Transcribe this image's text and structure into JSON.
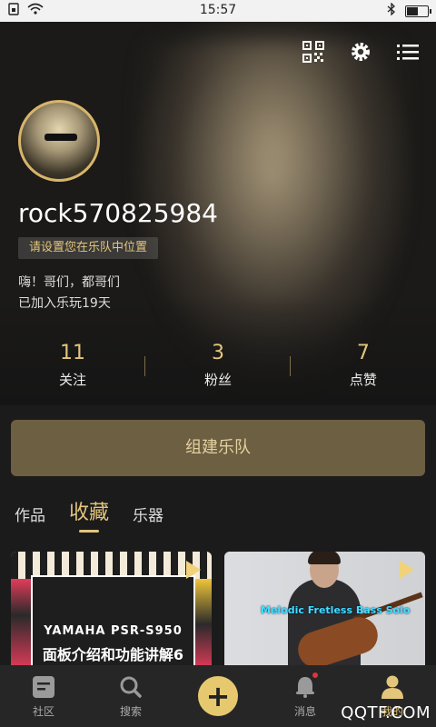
{
  "status_bar": {
    "time": "15:57"
  },
  "profile": {
    "username": "rock570825984",
    "position_tag": "请设置您在乐队中位置",
    "bio": "嗨！哥们，都哥们",
    "joined": "已加入乐玩19天"
  },
  "stats": [
    {
      "value": "11",
      "label": "关注"
    },
    {
      "value": "3",
      "label": "粉丝"
    },
    {
      "value": "7",
      "label": "点赞"
    }
  ],
  "form_band_label": "组建乐队",
  "tabs": [
    {
      "label": "作品",
      "active": false
    },
    {
      "label": "收藏",
      "active": true
    },
    {
      "label": "乐器",
      "active": false
    }
  ],
  "cards": [
    {
      "line1": "YAMAHA PSR-S950",
      "line2": "面板介绍和功能讲解6"
    },
    {
      "caption": "Melodic Fretless Bass Solo"
    }
  ],
  "bottom_nav": [
    {
      "label": "社区",
      "icon": "community-icon"
    },
    {
      "label": "搜索",
      "icon": "search-icon"
    },
    {
      "label": "",
      "icon": "plus-icon"
    },
    {
      "label": "消息",
      "icon": "bell-icon"
    },
    {
      "label": "我的",
      "icon": "profile-icon",
      "active": true
    }
  ],
  "watermark": "QQTF.COM",
  "colors": {
    "accent": "#e3c57b",
    "button": "#6d5f42",
    "nav_bg": "#262626"
  }
}
